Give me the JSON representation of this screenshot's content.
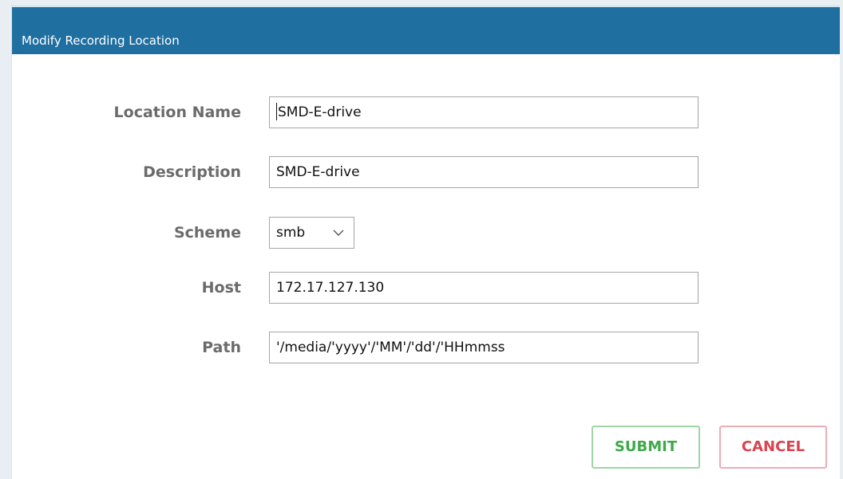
{
  "dialog": {
    "title": "Modify Recording Location"
  },
  "form": {
    "location_name": {
      "label": "Location Name",
      "value": "SMD-E-drive"
    },
    "description": {
      "label": "Description",
      "value": "SMD-E-drive"
    },
    "scheme": {
      "label": "Scheme",
      "value": "smb",
      "icon": "chevron-down-icon"
    },
    "host": {
      "label": "Host",
      "value": "172.17.127.130"
    },
    "path": {
      "label": "Path",
      "value": "'/media/'yyyy'/'MM'/'dd'/'HHmmss"
    }
  },
  "buttons": {
    "submit_label": "SUBMIT",
    "cancel_label": "CANCEL"
  },
  "colors": {
    "titlebar": "#1f6fa0",
    "submit": "#3ea84a",
    "cancel": "#d9434f"
  }
}
